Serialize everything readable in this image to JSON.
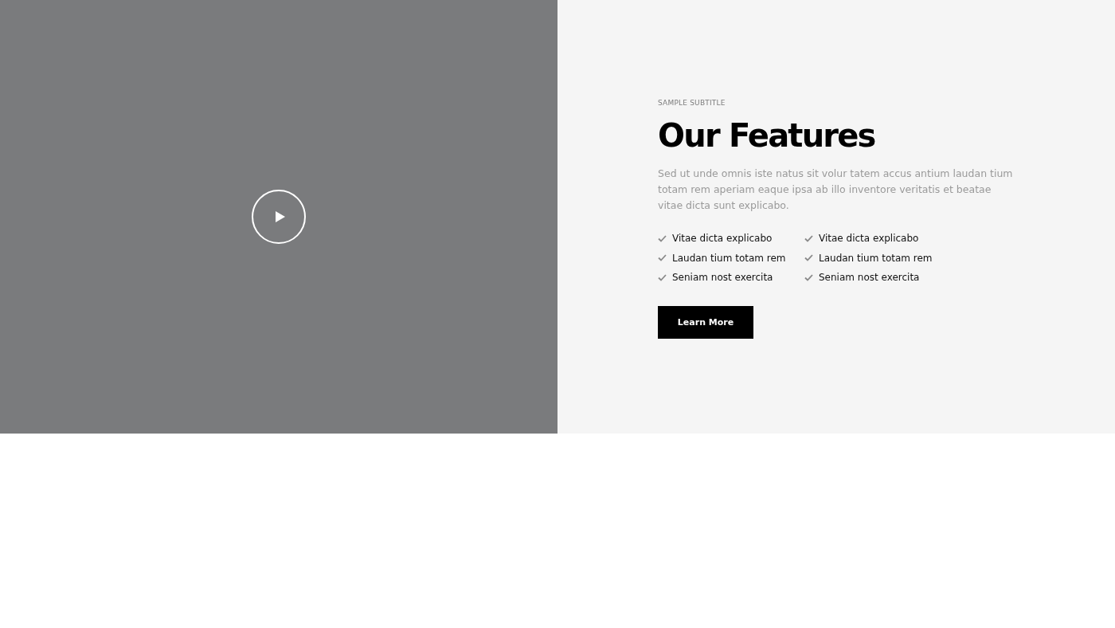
{
  "video": {
    "kind": "placeholder"
  },
  "features": {
    "subtitle": "SAMPLE SUBTITLE",
    "title": "Our Features",
    "description": "Sed ut unde omnis iste natus sit volur tatem accus antium laudan tium totam rem aperiam eaque ipsa ab illo inventore veritatis et beatae vitae dicta sunt explicabo.",
    "columns": [
      [
        "Vitae dicta explicabo",
        "Laudan tium totam rem",
        "Seniam nost exercita"
      ],
      [
        "Vitae dicta explicabo",
        "Laudan tium totam rem",
        "Seniam nost exercita"
      ]
    ],
    "button": "Learn More"
  }
}
